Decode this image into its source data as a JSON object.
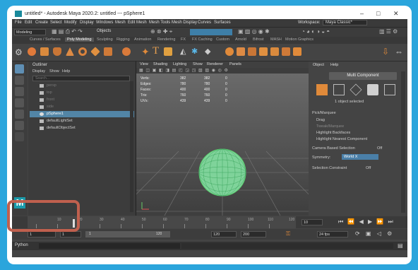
{
  "window": {
    "title": "untitled* - Autodesk Maya 2020.2: untitled  ---  pSphere1"
  },
  "menubar": {
    "items": [
      "File",
      "Edit",
      "Create",
      "Select",
      "Modify",
      "Display",
      "Windows",
      "Mesh",
      "Edit Mesh",
      "Mesh Tools",
      "Mesh Display",
      "Curves",
      "Surfaces"
    ],
    "workspace_label": "Workspace:",
    "workspace_value": "Maya Classic*"
  },
  "toolbar": {
    "mode": "Modeling",
    "objects": "Objects"
  },
  "shelf_tabs": [
    "Curves / Surfaces",
    "Poly Modeling",
    "Sculpting",
    "Rigging",
    "Animation",
    "Rendering",
    "FX",
    "FX Caching",
    "Custom",
    "Arnold",
    "Bifrost",
    "MASH",
    "Motion Graphics"
  ],
  "shelf_active": "Poly Modeling",
  "outliner": {
    "title": "Outliner",
    "menu": [
      "Display",
      "Show",
      "Help"
    ],
    "search_placeholder": "Search...",
    "items": [
      {
        "label": "persp",
        "state": "dim"
      },
      {
        "label": "top",
        "state": "dim"
      },
      {
        "label": "front",
        "state": "dim"
      },
      {
        "label": "side",
        "state": "dim"
      },
      {
        "label": "pSphere1",
        "state": "sel"
      },
      {
        "label": "defaultLightSet",
        "state": "normal"
      },
      {
        "label": "defaultObjectSet",
        "state": "normal"
      }
    ]
  },
  "viewport": {
    "menu": [
      "View",
      "Shading",
      "Lighting",
      "Show",
      "Renderer",
      "Panels"
    ],
    "hud": [
      {
        "label": "Verts:",
        "a": "382",
        "b": "382",
        "c": "0"
      },
      {
        "label": "Edges:",
        "a": "780",
        "b": "780",
        "c": "0"
      },
      {
        "label": "Faces:",
        "a": "400",
        "b": "400",
        "c": "0"
      },
      {
        "label": "Tris:",
        "a": "760",
        "b": "760",
        "c": "0"
      },
      {
        "label": "UVs:",
        "a": "439",
        "b": "439",
        "c": "0"
      }
    ]
  },
  "attr": {
    "tabs": [
      "Object",
      "Help"
    ],
    "multi_component": "Multi Component",
    "selected_count": "1 object selected",
    "section": "Pick/Marquee",
    "drag": "Drag",
    "tweak": "Tweak/Marquee",
    "highlight_backfaces": "Highlight Backfaces",
    "highlight_nearest": "Highlight Nearest Component",
    "camera_deselection": "Camera Based Selection",
    "camera_value": "Off",
    "symmetry_label": "Symmetry:",
    "symmetry_value": "World X",
    "constraint_label": "Selection Constraint",
    "constraint_value": "Off"
  },
  "timeline": {
    "ticks": [
      "10",
      "20",
      "30",
      "40",
      "50",
      "60",
      "70",
      "80",
      "90",
      "100",
      "110",
      "120"
    ],
    "current_frame": "10",
    "frame_field": "10"
  },
  "range": {
    "start": "1",
    "playback_start": "1",
    "playback_end": "120",
    "end": "120",
    "anim_end": "200",
    "fps": "24 fps"
  },
  "cmd": {
    "label": "Python"
  }
}
